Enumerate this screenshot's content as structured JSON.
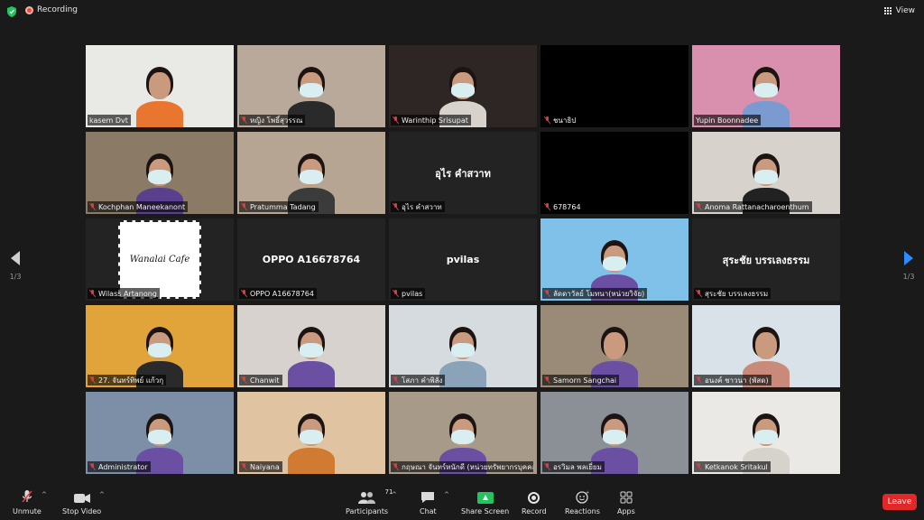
{
  "topbar": {
    "recording_label": "Recording",
    "view_label": "View",
    "accent": "#e74c3c"
  },
  "pager": {
    "left_label": "1/3",
    "right_label": "1/3",
    "active_color": "#2b8cff"
  },
  "participants": [
    {
      "name": "kasem Dvt",
      "muted": false,
      "bg": "#e9e9e6",
      "shirt": "#e8762f",
      "mask": false
    },
    {
      "name": "หญิง โพธิ์สุวรรณ",
      "muted": true,
      "bg": "#b9a99a",
      "shirt": "#2a2a2a",
      "mask": true
    },
    {
      "name": "Warinthip Srisupat",
      "muted": true,
      "bg": "#2d2624",
      "shirt": "#d8d2cc",
      "mask": true
    },
    {
      "name": "ชนาธิป",
      "muted": true,
      "bg": "#000000",
      "shirt": null,
      "mask": false
    },
    {
      "name": "Yupin Boonnadee",
      "muted": false,
      "bg": "#d98fae",
      "shirt": "#7a9ad0",
      "mask": true,
      "active": true
    },
    {
      "name": "Kochphan Maneekanont",
      "muted": true,
      "bg": "#8b7a66",
      "shirt": "#5a3f8c",
      "mask": true
    },
    {
      "name": "Pratumma Tadang",
      "muted": true,
      "bg": "#b6a593",
      "shirt": "#3b3b3b",
      "mask": true
    },
    {
      "name": "อุไร คำสวาท",
      "muted": true,
      "bg": "#232323",
      "shirt": null,
      "mask": false,
      "center": "อุไร คำสวาท"
    },
    {
      "name": "678764",
      "muted": true,
      "bg": "#000000",
      "shirt": null,
      "mask": false
    },
    {
      "name": "Anoma Rattanacharoenthum",
      "muted": true,
      "bg": "#d8d2cc",
      "shirt": "#222222",
      "mask": true
    },
    {
      "name": "Wilass Artanong",
      "muted": true,
      "bg": "#232323",
      "shirt": null,
      "mask": false,
      "logo": "Wanalai Cafe"
    },
    {
      "name": "OPPO A16678764",
      "muted": true,
      "bg": "#232323",
      "shirt": null,
      "mask": false,
      "center": "OPPO A16678764"
    },
    {
      "name": "pvilas",
      "muted": true,
      "bg": "#232323",
      "shirt": null,
      "mask": false,
      "center": "pvilas"
    },
    {
      "name": "ลัดดาวัลย์ โมทนา(หน่วยวิจัย)",
      "muted": true,
      "bg": "#7fc1e8",
      "shirt": "#6a4fa3",
      "mask": true
    },
    {
      "name": "สุระชัย บรรเลงธรรม",
      "muted": true,
      "bg": "#232323",
      "shirt": null,
      "mask": false,
      "center": "สุระชัย บรรเลงธรรม"
    },
    {
      "name": "27. จันทร์ทิพย์ แก้วกุ",
      "muted": true,
      "bg": "#e0a43a",
      "shirt": "#2a2a2a",
      "mask": true
    },
    {
      "name": "Chanwit",
      "muted": true,
      "bg": "#d7d2cd",
      "shirt": "#6a4fa3",
      "mask": true
    },
    {
      "name": "โสภา คำพิลัง",
      "muted": true,
      "bg": "#d6dbe0",
      "shirt": "#8aa3b8",
      "mask": true
    },
    {
      "name": "Samorn Sangchai",
      "muted": true,
      "bg": "#9a8b78",
      "shirt": "#6a4fa3",
      "mask": false
    },
    {
      "name": "อนงค์ ชาวนา (พัสด)",
      "muted": true,
      "bg": "#d9e2e8",
      "shirt": "#c98a7a",
      "mask": false
    },
    {
      "name": "Administrator",
      "muted": true,
      "bg": "#7d8fa6",
      "shirt": "#6a4fa3",
      "mask": true
    },
    {
      "name": "Naiyana",
      "muted": true,
      "bg": "#e0c3a0",
      "shirt": "#d07a32",
      "mask": true
    },
    {
      "name": "กฤษณา จันทร์หนักดี (หน่วยทรัพยากรบุคคล)",
      "muted": true,
      "bg": "#a89a88",
      "shirt": "#6a4fa3",
      "mask": true
    },
    {
      "name": "อรวิมล พลเยี่ยม",
      "muted": true,
      "bg": "#8b8f96",
      "shirt": "#6a4fa3",
      "mask": true
    },
    {
      "name": "Ketkanok Sritakul",
      "muted": true,
      "bg": "#ebe9e6",
      "shirt": "#d6d2cc",
      "mask": true
    }
  ],
  "toolbar": {
    "unmute": "Unmute",
    "stop_video": "Stop Video",
    "participants": "Participants",
    "participants_count": "71",
    "chat": "Chat",
    "share_screen": "Share Screen",
    "record": "Record",
    "reactions": "Reactions",
    "apps": "Apps",
    "leave": "Leave"
  },
  "colors": {
    "leave": "#e02828",
    "share": "#23c45e",
    "active_speaker": "#d6d64a"
  }
}
